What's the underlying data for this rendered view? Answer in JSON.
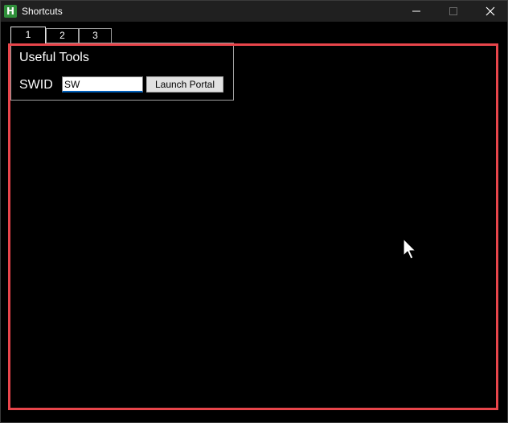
{
  "window": {
    "title": "Shortcuts",
    "icon_letter": "H",
    "icon": "app-h-icon",
    "controls": {
      "minimize_icon": "minimize-icon",
      "maximize_icon": "maximize-icon",
      "close_icon": "close-icon"
    }
  },
  "tabs": [
    {
      "label": "1",
      "active": true
    },
    {
      "label": "2",
      "active": false
    },
    {
      "label": "3",
      "active": false
    }
  ],
  "group": {
    "title": "Useful Tools",
    "swid_label": "SWID",
    "swid_value": "SW",
    "launch_label": "Launch Portal"
  },
  "colors": {
    "background": "#000000",
    "titlebar": "#202020",
    "highlight_border": "#e8454b",
    "input_focus": "#005fb8",
    "app_icon": "#2f8f3a"
  }
}
